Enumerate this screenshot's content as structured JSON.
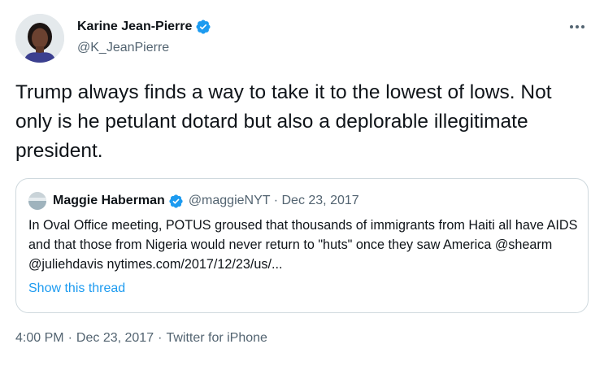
{
  "author": {
    "name": "Karine Jean-Pierre",
    "handle": "@K_JeanPierre",
    "avatar_icon": "profile-photo"
  },
  "tweet": {
    "text": "Trump always finds a way to take it to the lowest of lows. Not only is he petulant dotard but also a deplorable illegitimate president."
  },
  "quoted": {
    "name": "Maggie Haberman",
    "handle": "@maggieNYT",
    "separator": "·",
    "date": "Dec 23, 2017",
    "text": "In Oval Office meeting, POTUS groused that thousands of immigrants from Haiti all have AIDS and that those from Nigeria would never return to \"huts\" once they saw America @shearm @juliehdavis nytimes.com/2017/12/23/us/...",
    "show_thread": "Show this thread"
  },
  "footer": {
    "time": "4:00 PM",
    "separator": "·",
    "date": "Dec 23, 2017",
    "source": "Twitter for iPhone"
  },
  "colors": {
    "verified": "#1d9bf0",
    "link": "#1d9bf0",
    "secondary_text": "#536471",
    "border": "#cfd9de"
  },
  "icons": {
    "more": "more-horizontal-icon",
    "verified": "verified-badge-icon"
  }
}
